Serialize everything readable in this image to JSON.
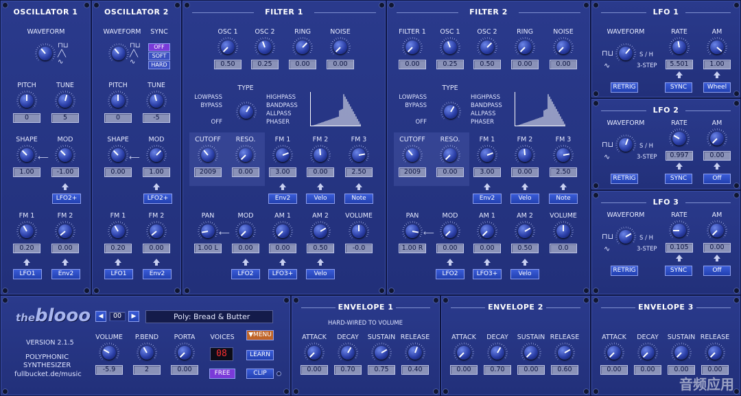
{
  "osc1": {
    "title": "OSCILLATOR 1",
    "waveform": "WAVEFORM",
    "pitch": "PITCH",
    "tune": "TUNE",
    "pitch_val": "0",
    "tune_val": "5",
    "shape": "SHAPE",
    "mod": "MOD",
    "shape_val": "1.00",
    "mod_val": "-1.00",
    "mod_src": "LFO2+",
    "fm1": "FM 1",
    "fm2": "FM 2",
    "fm1_val": "0.20",
    "fm2_val": "0.00",
    "fm1_src": "LFO1",
    "fm2_src": "Env2"
  },
  "osc2": {
    "title": "OSCILLATOR 2",
    "waveform": "WAVEFORM",
    "sync": "SYNC",
    "sync_off": "OFF",
    "sync_soft": "SOFT",
    "sync_hard": "HARD",
    "pitch": "PITCH",
    "tune": "TUNE",
    "pitch_val": "0",
    "tune_val": "-5",
    "shape": "SHAPE",
    "mod": "MOD",
    "shape_val": "0.00",
    "mod_val": "1.00",
    "mod_src": "LFO2+",
    "fm1": "FM 1",
    "fm2": "FM 2",
    "fm1_val": "0.20",
    "fm2_val": "0.00",
    "fm1_src": "LFO1",
    "fm2_src": "Env2"
  },
  "filter1": {
    "title": "FILTER 1",
    "mix": [
      "OSC 1",
      "OSC 2",
      "RING",
      "NOISE"
    ],
    "mix_vals": [
      "0.50",
      "0.25",
      "0.00",
      "0.00"
    ],
    "type": "TYPE",
    "types_l": [
      "LOWPASS",
      "BYPASS",
      "OFF"
    ],
    "types_r": [
      "HIGHPASS",
      "BANDPASS",
      "ALLPASS",
      "PHASER"
    ],
    "cutoff": "CUTOFF",
    "reso": "RESO.",
    "cutoff_val": "2009",
    "reso_val": "0.00",
    "fm": [
      "FM 1",
      "FM 2",
      "FM 3"
    ],
    "fm_vals": [
      "3.00",
      "0.00",
      "2.50"
    ],
    "fm_src": [
      "Env2",
      "Velo",
      "Note"
    ],
    "pan": "PAN",
    "mod": "MOD",
    "am1": "AM 1",
    "am2": "AM 2",
    "volume": "VOLUME",
    "pan_val": "1.00 L",
    "mod_val": "0.00",
    "am1_val": "0.00",
    "am2_val": "0.50",
    "volume_val": "-0.0",
    "mod_src": "LFO2",
    "am1_src": "LFO3+",
    "am2_src": "Velo"
  },
  "filter2": {
    "title": "FILTER 2",
    "mix": [
      "FILTER 1",
      "OSC 1",
      "OSC 2",
      "RING",
      "NOISE"
    ],
    "mix_vals": [
      "0.00",
      "0.25",
      "0.50",
      "0.00",
      "0.00"
    ],
    "type": "TYPE",
    "types_l": [
      "LOWPASS",
      "BYPASS",
      "OFF"
    ],
    "types_r": [
      "HIGHPASS",
      "BANDPASS",
      "ALLPASS",
      "PHASER"
    ],
    "cutoff": "CUTOFF",
    "reso": "RESO.",
    "cutoff_val": "2009",
    "reso_val": "0.00",
    "fm": [
      "FM 1",
      "FM 2",
      "FM 3"
    ],
    "fm_vals": [
      "3.00",
      "0.00",
      "2.50"
    ],
    "fm_src": [
      "Env2",
      "Velo",
      "Note"
    ],
    "pan": "PAN",
    "mod": "MOD",
    "am1": "AM 1",
    "am2": "AM 2",
    "volume": "VOLUME",
    "pan_val": "1.00 R",
    "mod_val": "0.00",
    "am1_val": "0.00",
    "am2_val": "0.50",
    "volume_val": "0.0",
    "mod_src": "LFO2",
    "am1_src": "LFO3+",
    "am2_src": "Velo"
  },
  "lfo": [
    {
      "title": "LFO 1",
      "waveform": "WAVEFORM",
      "rate": "RATE",
      "am": "AM",
      "rate_val": "5.501",
      "am_val": "1.00",
      "retrig": "RETRIG",
      "sync": "SYNC",
      "am_src": "Wheel",
      "sh": "S / H",
      "step": "3-STEP"
    },
    {
      "title": "LFO 2",
      "waveform": "WAVEFORM",
      "rate": "RATE",
      "am": "AM",
      "rate_val": "0.997",
      "am_val": "0.00",
      "retrig": "RETRIG",
      "sync": "SYNC",
      "am_src": "Off",
      "sh": "S / H",
      "step": "3-STEP"
    },
    {
      "title": "LFO 3",
      "waveform": "WAVEFORM",
      "rate": "RATE",
      "am": "AM",
      "rate_val": "0.105",
      "am_val": "0.00",
      "retrig": "RETRIG",
      "sync": "SYNC",
      "am_src": "Off",
      "sh": "S / H",
      "step": "3-STEP"
    }
  ],
  "global": {
    "logo_a": "the",
    "logo_b": "blooo",
    "version": "VERSION 2.1.5",
    "desc1": "POLYPHONIC",
    "desc2": "SYNTHESIZER",
    "url": "fullbucket.de/music",
    "prog_num": "00",
    "prog_name": "Poly: Bread & Butter",
    "volume": "VOLUME",
    "pbend": "P.BEND",
    "porta": "PORTA",
    "voices": "VOICES",
    "volume_val": "-5.9",
    "pbend_val": "2",
    "porta_val": "0.00",
    "voices_val": "08",
    "free": "FREE",
    "menu": "▼MENU",
    "learn": "LEARN",
    "clip": "CLIP"
  },
  "env": [
    {
      "title": "ENVELOPE 1",
      "sub": "HARD-WIRED TO VOLUME",
      "a": "ATTACK",
      "d": "DECAY",
      "s": "SUSTAIN",
      "r": "RELEASE",
      "av": "0.00",
      "dv": "0.70",
      "sv": "0.75",
      "rv": "0.40"
    },
    {
      "title": "ENVELOPE 2",
      "sub": "",
      "a": "ATTACK",
      "d": "DECAY",
      "s": "SUSTAIN",
      "r": "RELEASE",
      "av": "0.00",
      "dv": "0.70",
      "sv": "0.00",
      "rv": "0.60"
    },
    {
      "title": "ENVELOPE 3",
      "sub": "",
      "a": "ATTACK",
      "d": "DECAY",
      "s": "SUSTAIN",
      "r": "RELEASE",
      "av": "0.00",
      "dv": "0.00",
      "sv": "0.00",
      "rv": "0.00"
    }
  ],
  "watermark": "音频应用"
}
